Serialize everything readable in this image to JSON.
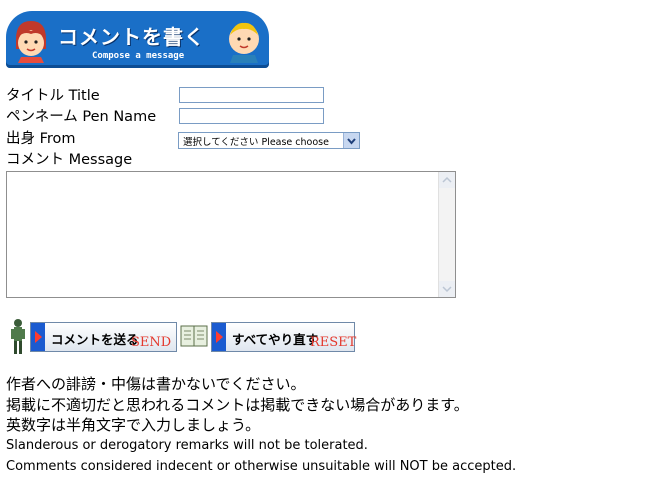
{
  "header": {
    "title": "コメントを書く",
    "subtitle": "Compose a message"
  },
  "form": {
    "title_label": "タイトル Title",
    "title_value": "",
    "pen_name_label": "ペンネーム Pen Name",
    "pen_name_value": "",
    "from_label": "出身 From",
    "from_selected": "選択してください Please choose",
    "message_label": "コメント Message",
    "message_value": ""
  },
  "buttons": {
    "send_jp": "コメントを送る",
    "send_en": "SEND",
    "reset_jp": "すべてやり直す",
    "reset_en": "RESET"
  },
  "notes": {
    "line1": "作者への誹謗・中傷は書かないでください。",
    "line2": "掲載に不適切だと思われるコメントは掲載できない場合があります。",
    "line3": "英数字は半角文字で入力しましょう。",
    "line4": "Slanderous or derogatory remarks will not be tolerated.",
    "line5": "Comments considered indecent or otherwise unsuitable will NOT be accepted."
  },
  "colors": {
    "banner": "#1a6fc7",
    "button_arrow": "#1b5bd0",
    "button_accent": "#e4382d"
  }
}
